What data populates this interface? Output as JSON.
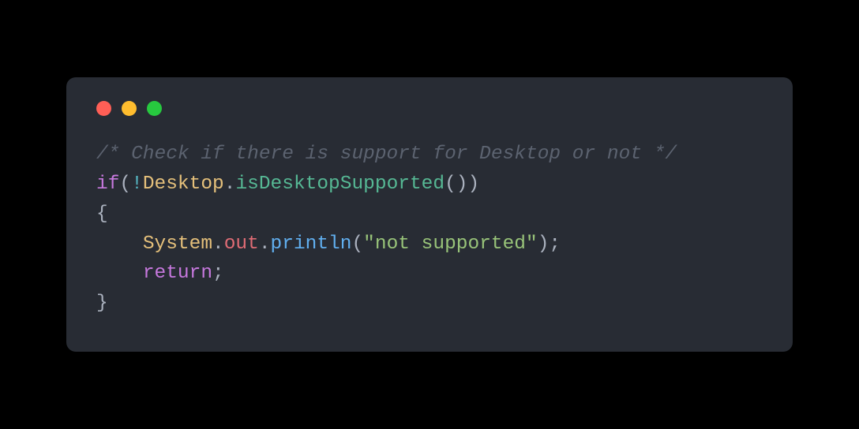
{
  "code": {
    "line1_comment": "/* Check if there is support for Desktop or not */",
    "line2": {
      "if": "if",
      "paren_open": "(",
      "not": "!",
      "class": "Desktop",
      "dot": ".",
      "method": "isDesktopSupported",
      "parens": "()",
      "paren_close": ")"
    },
    "line3_brace_open": "{",
    "line4": {
      "indent": "    ",
      "class": "System",
      "dot1": ".",
      "out": "out",
      "dot2": ".",
      "println": "println",
      "paren_open": "(",
      "string": "\"not supported\"",
      "paren_close": ")",
      "semi": ";"
    },
    "line5": {
      "indent": "    ",
      "return": "return",
      "semi": ";"
    },
    "line6_brace_close": "}"
  }
}
